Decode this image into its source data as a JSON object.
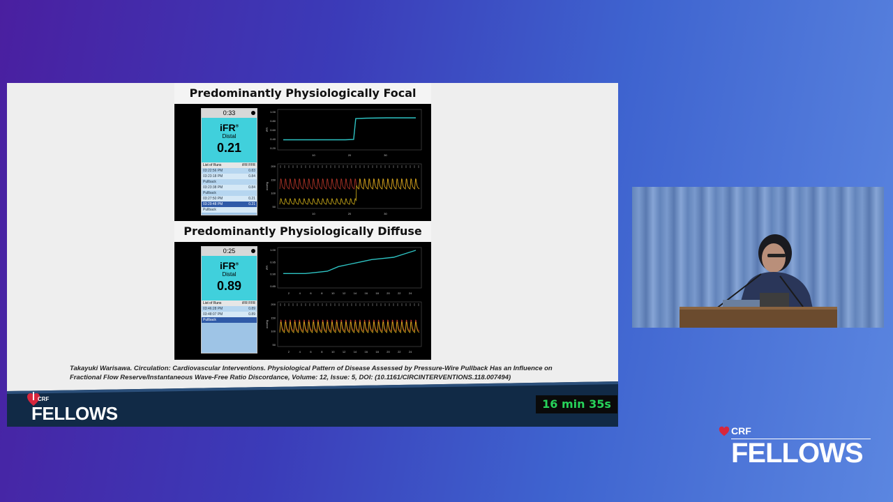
{
  "slide": {
    "figure": {
      "panels": [
        {
          "title": "Predominantly Physiologically Focal",
          "device": {
            "timer": "0:33",
            "metric": "iFR",
            "registered": "®",
            "location": "Distal",
            "value": "0.21",
            "runs_header": "List of Runs",
            "runs_cols": "iFR  FFR",
            "runs": [
              {
                "time": "03:22:56 PM",
                "val": "0.83"
              },
              {
                "time": "03:23:18 PM",
                "val": "0.84"
              },
              {
                "time": "Pullback",
                "val": ""
              },
              {
                "time": "03:23:38 PM",
                "val": "0.84"
              },
              {
                "time": "Pullback",
                "val": ""
              },
              {
                "time": "03:27:50 PM",
                "val": "0.21"
              },
              {
                "time": "03:29:48 PM",
                "val": "0.21"
              },
              {
                "time": "Pullback",
                "val": ""
              }
            ]
          }
        },
        {
          "title": "Predominantly Physiologically Diffuse",
          "device": {
            "timer": "0:25",
            "metric": "iFR",
            "registered": "®",
            "location": "Distal",
            "value": "0.89",
            "runs_header": "List of Runs",
            "runs_cols": "iFR  FFR",
            "runs": [
              {
                "time": "03:46:28 PM",
                "val": "0.89"
              },
              {
                "time": "03:48:07 PM",
                "val": "0.89"
              },
              {
                "time": "Pullback",
                "val": ""
              }
            ]
          }
        }
      ]
    },
    "citation_line1": "Takayuki Warisawa. Circulation: Cardiovascular Interventions. Physiological Pattern of Disease Assessed by Pressure-Wire Pullback Has an Influence on",
    "citation_line2": "Fractional Flow Reserve/Instantaneous Wave-Free Ratio Discordance, Volume: 12, Issue: 5, DOI: (10.1161/CIRCINTERVENTIONS.118.007494)",
    "banner": {
      "crf_label": "CRF",
      "fellows_label": "FELLOWS"
    },
    "timer": "16 min 35s"
  },
  "overlay_logo": {
    "crf_label": "CRF",
    "fellows_label": "FELLOWS"
  },
  "colors": {
    "ifr_trace": "#2ec4c4",
    "pa_trace": "#c0392b",
    "pd_trace": "#d4b21a",
    "timer_text": "#27d35a",
    "heart_red": "#d7263d"
  },
  "chart_data": [
    {
      "type": "line",
      "title": "",
      "xlabel": "",
      "ylabel": "iFR",
      "x": [
        0,
        5,
        10,
        15,
        17,
        17.5,
        20,
        25,
        30,
        32
      ],
      "series": [
        {
          "values": [
            0.21,
            0.21,
            0.21,
            0.21,
            0.22,
            0.82,
            0.83,
            0.84,
            0.84,
            0.84
          ]
        }
      ],
      "xticks": [
        "10",
        "20",
        "30"
      ],
      "yticks": [
        "1.00",
        "0.80",
        "0.60",
        "0.40",
        "0.20"
      ],
      "ylim": [
        0.0,
        1.0
      ]
    },
    {
      "type": "line",
      "title": "",
      "xlabel": "",
      "ylabel": "mmHg",
      "yticks": [
        "200",
        "150",
        "100",
        "50"
      ],
      "xticks": [
        "10",
        "20",
        "30"
      ],
      "ylim": [
        0,
        200
      ]
    },
    {
      "type": "line",
      "title": "",
      "xlabel": "",
      "ylabel": "iFR",
      "x": [
        0,
        2,
        4,
        6,
        8,
        10,
        12,
        14,
        16,
        18,
        20,
        22,
        24
      ],
      "series": [
        {
          "values": [
            0.9,
            0.9,
            0.9,
            0.905,
            0.91,
            0.93,
            0.94,
            0.95,
            0.96,
            0.965,
            0.97,
            0.985,
            1.0
          ]
        }
      ],
      "xticks": [
        "2",
        "4",
        "6",
        "8",
        "10",
        "12",
        "14",
        "16",
        "18",
        "20",
        "22",
        "24"
      ],
      "yticks": [
        "1.00",
        "0.95",
        "0.90",
        "0.85"
      ],
      "ylim": [
        0.85,
        1.0
      ]
    },
    {
      "type": "line",
      "title": "",
      "xlabel": "",
      "ylabel": "mmHg",
      "yticks": [
        "200",
        "150",
        "100",
        "50"
      ],
      "xticks": [
        "2",
        "4",
        "6",
        "8",
        "10",
        "12",
        "14",
        "16",
        "18",
        "20",
        "22",
        "24"
      ],
      "ylim": [
        0,
        200
      ]
    }
  ]
}
